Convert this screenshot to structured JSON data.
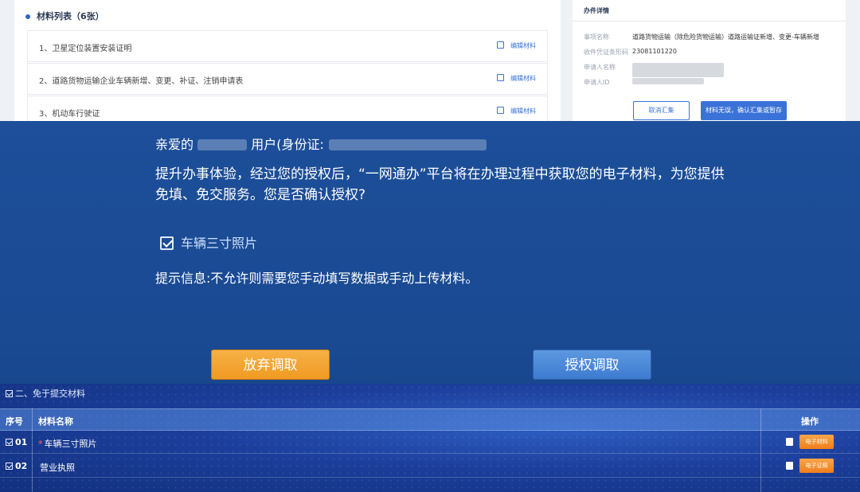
{
  "materials": {
    "title": "材料列表（6张）",
    "items": [
      {
        "name": "1、卫星定位装置安装证明",
        "action": "编辑材料"
      },
      {
        "name": "2、道路货物运输企业车辆新增、变更、补证、注销申请表",
        "action": "编辑材料"
      },
      {
        "name": "3、机动车行驶证",
        "action": "编辑材料"
      }
    ]
  },
  "detail": {
    "title": "办件详情",
    "fields": [
      {
        "label": "事项名称",
        "value": "道路货物运输（除危险货物运输）道路运输证新增、变更-车辆新增"
      },
      {
        "label": "收件凭证条形码",
        "value": "23081101220"
      },
      {
        "label": "申请人名称",
        "value": ""
      },
      {
        "label": "申请人ID",
        "value": ""
      }
    ],
    "cancel_label": "取消汇集",
    "save_label": "材料无误，确认汇集或暂存"
  },
  "dialog": {
    "greeting_prefix": "亲爱的",
    "greeting_middle": "用户(身份证:",
    "paragraph": "提升办事体验，经过您的授权后，“一网通办”平台将在办理过程中获取您的电子材料，为您提供免填、免交服务。您是否确认授权?",
    "auth_item": "车辆三寸照片",
    "tip": "提示信息:不允许则需要您手动填写数据或手动上传材料。",
    "abandon_label": "放弃调取",
    "authorize_label": "授权调取"
  },
  "exempt": {
    "title": "二、免于提交材料",
    "headers": {
      "no": "序号",
      "name": "材料名称",
      "op": "操作"
    },
    "rows": [
      {
        "no": "01",
        "star": "*",
        "name": "车辆三寸照片",
        "button": "电子材料"
      },
      {
        "no": "02",
        "star": "",
        "name": "营业执照",
        "button": "电子证照"
      }
    ]
  },
  "colors": {
    "dialog_bg": "#1b4b94",
    "accent_orange": "#f09a23",
    "accent_blue": "#3e7bd0"
  }
}
